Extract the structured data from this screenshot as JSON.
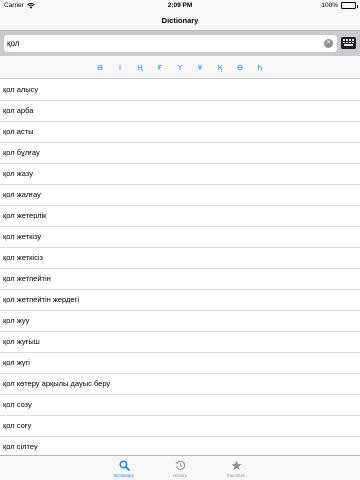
{
  "status_bar": {
    "carrier": "Carrier",
    "time": "2:09 PM",
    "battery": "100%"
  },
  "nav": {
    "title": "Dictionary"
  },
  "search": {
    "value": "қол"
  },
  "letters": [
    "Ә",
    "І",
    "Ң",
    "Ғ",
    "Ү",
    "Ұ",
    "Қ",
    "Ө",
    "Һ"
  ],
  "words": [
    "қол алысу",
    "қол арба",
    "қол асты",
    "қол бұлғау",
    "қол жазу",
    "қол жалғау",
    "қол жетерлік",
    "қол жеткізу",
    "қол жеткісіз",
    "қол жетпейтін",
    "қол жетпейтін жердегі",
    "қол жуу",
    "қол жуғыш",
    "қол жүгі",
    "қол көтеру арқылы дауыс беру",
    "қол созу",
    "қол соғу",
    "қол сілтеу"
  ],
  "tabs": [
    {
      "label": "Dictionary",
      "icon": "search-icon"
    },
    {
      "label": "History",
      "icon": "history-icon"
    },
    {
      "label": "Favorites",
      "icon": "star-icon"
    }
  ],
  "colors": {
    "accent": "#1a82fb",
    "inactive": "#929292",
    "search_bg": "#c9c9ce"
  }
}
